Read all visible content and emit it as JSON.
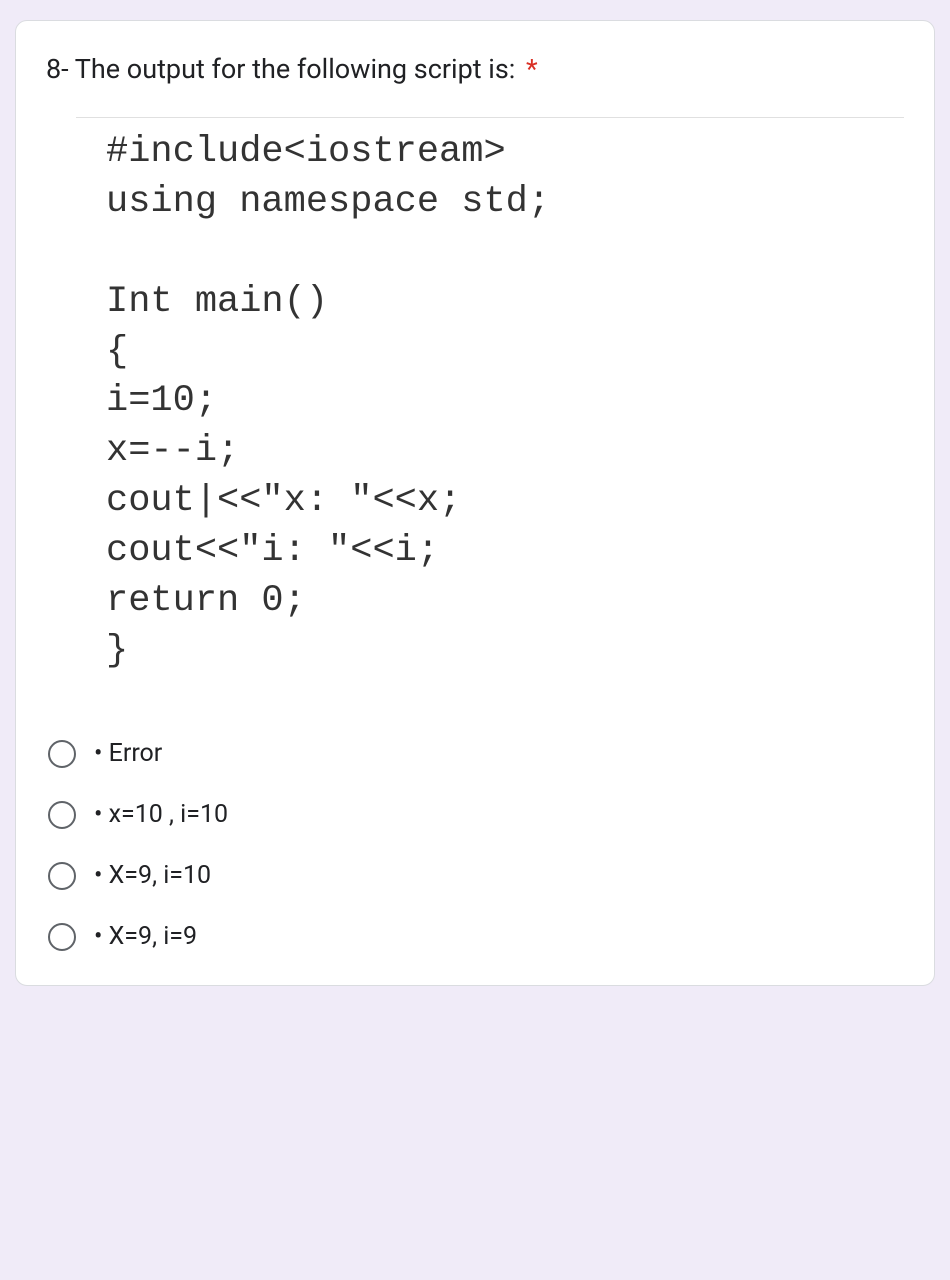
{
  "question": {
    "text": "8- The output for the following script is:",
    "required_marker": "*"
  },
  "code": {
    "lines": [
      "#include<iostream>",
      "using namespace std;",
      "",
      "Int main()",
      "{",
      "i=10;",
      "x=--i;",
      "cout|<<\"x: \"<<x;",
      "cout<<\"i: \"<<i;",
      "return 0;",
      "}"
    ]
  },
  "options": [
    {
      "label": "• Error"
    },
    {
      "label": "• x=10 , i=10"
    },
    {
      "label": "• X=9, i=10"
    },
    {
      "label": "• X=9, i=9"
    }
  ]
}
